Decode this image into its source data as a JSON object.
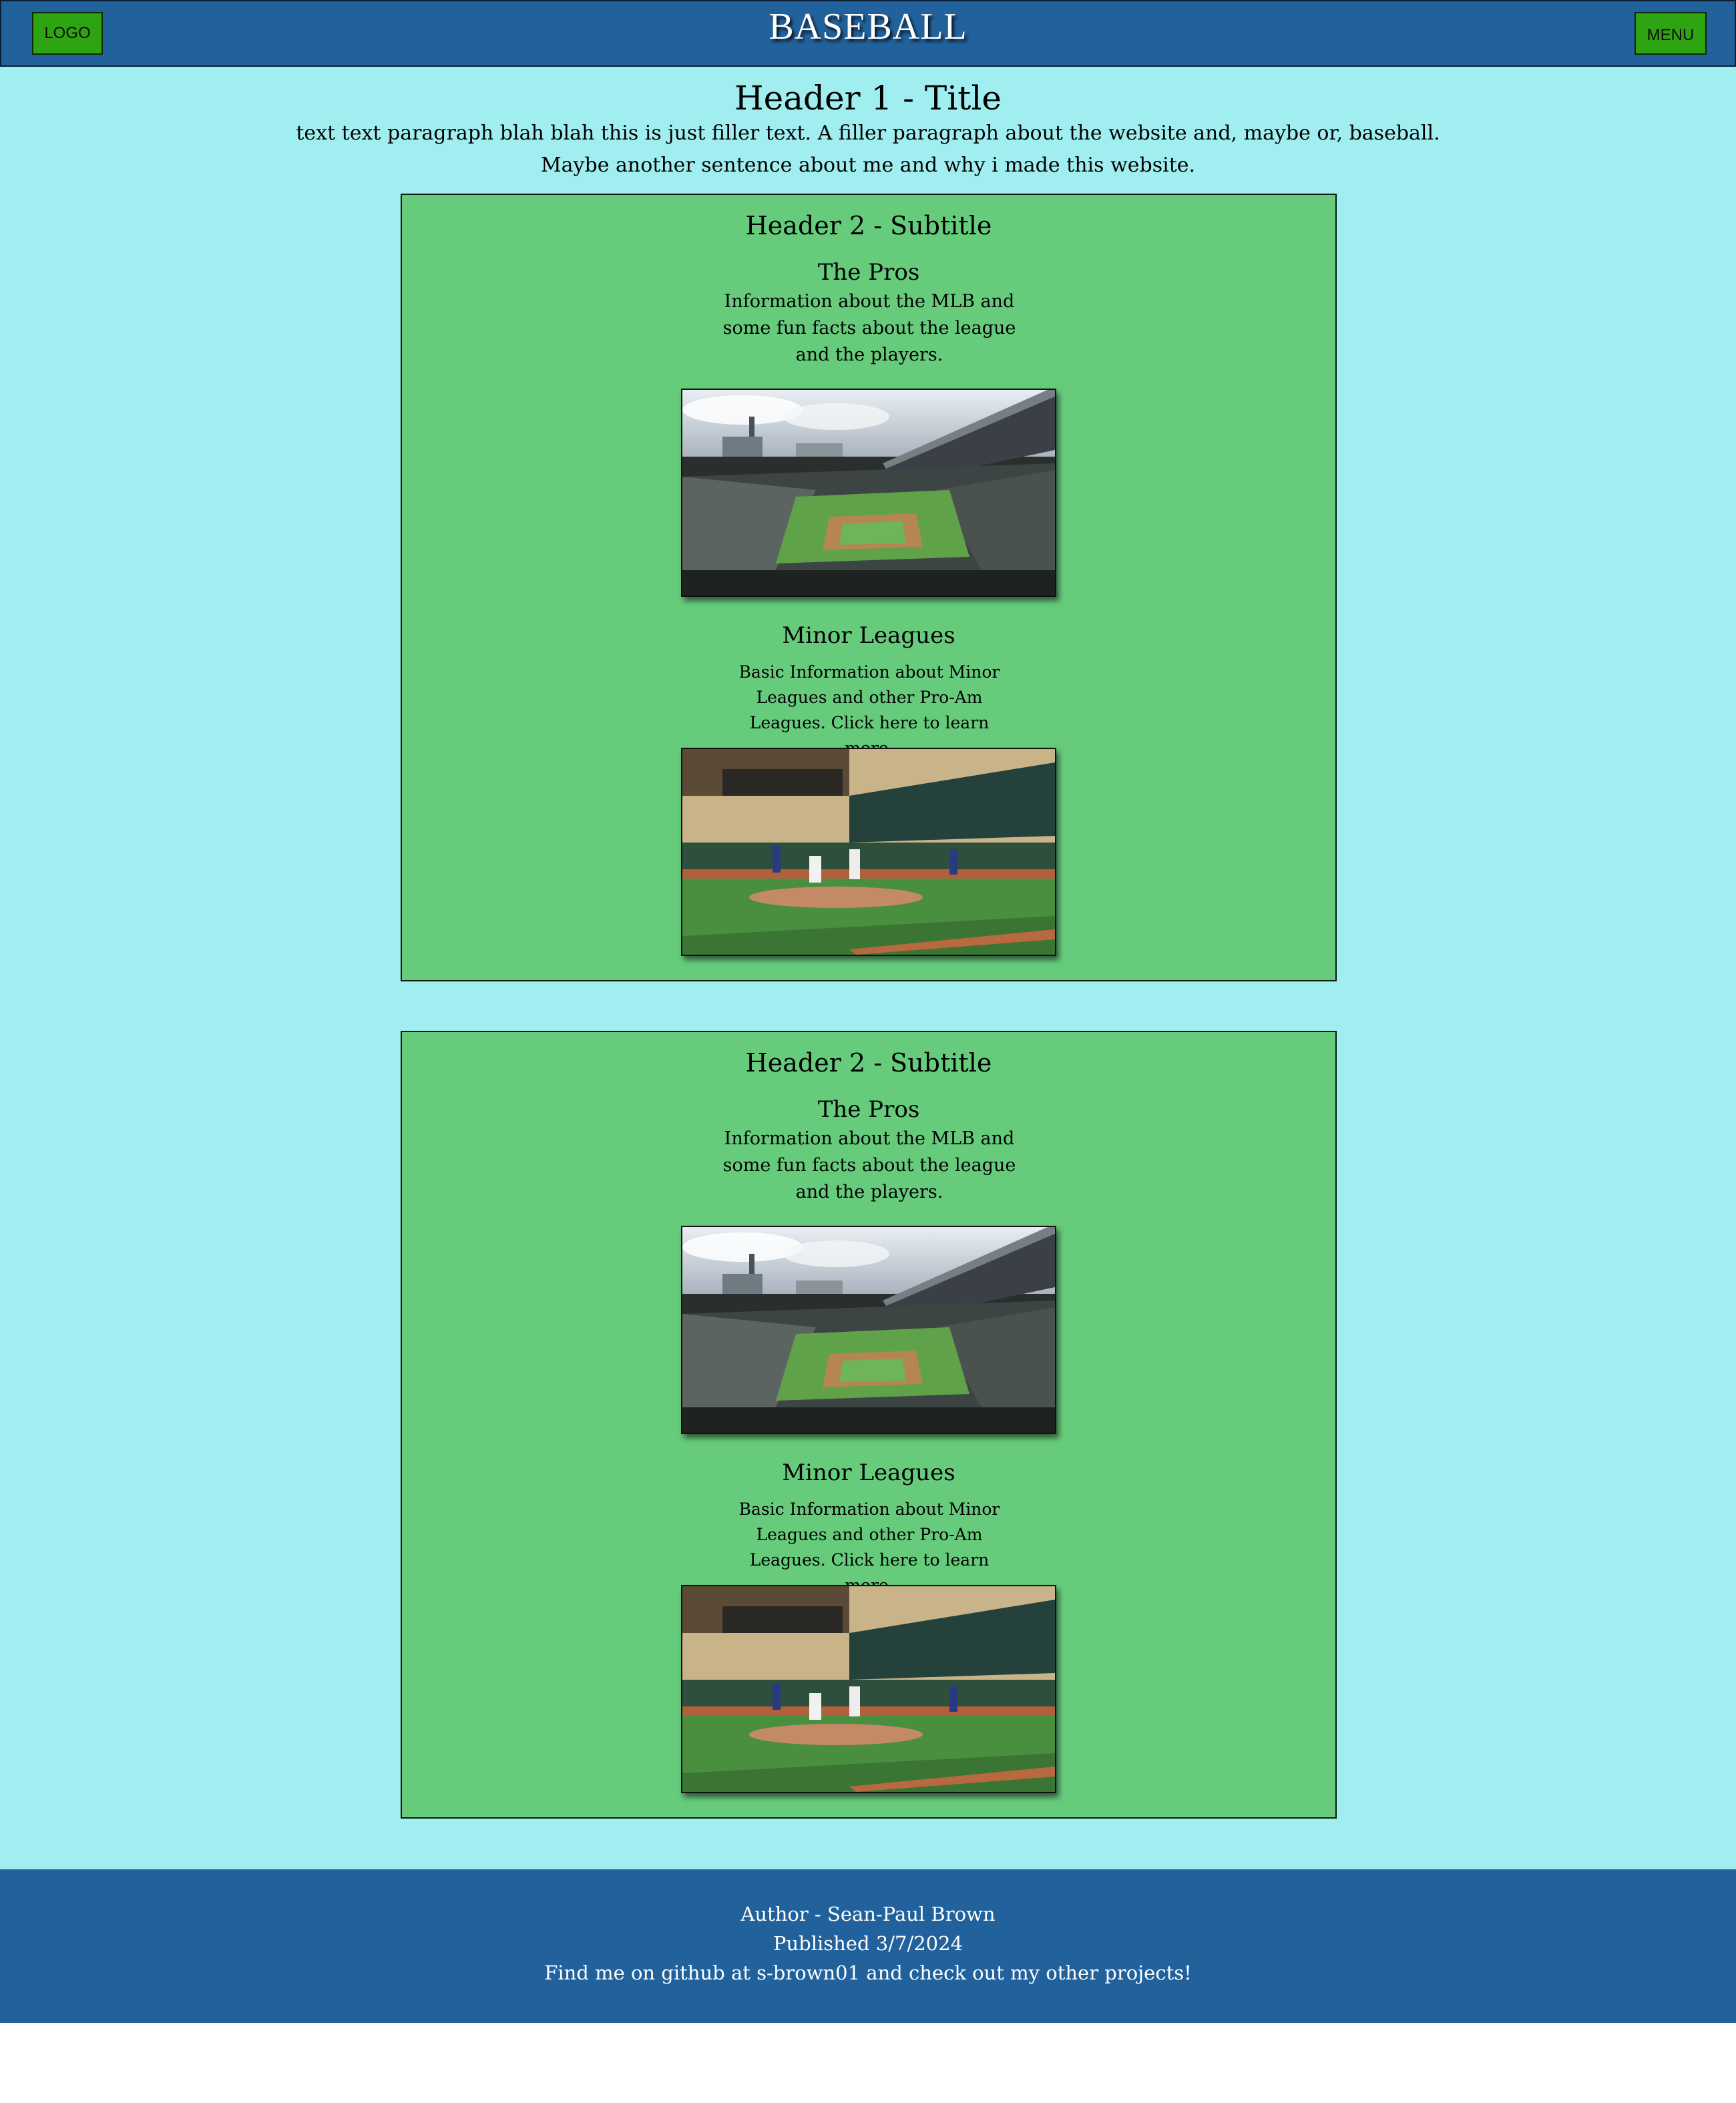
{
  "header": {
    "logo_label": "LOGO",
    "site_title": "BASEBALL",
    "menu_label": "MENU"
  },
  "intro": {
    "title": "Header 1 - Title",
    "paragraph": "text text paragraph blah blah this is just filler text. A filler paragraph about the website and, maybe or, baseball. Maybe another sentence about me and why i made this website."
  },
  "sections": [
    {
      "title": "Header 2 - Subtitle",
      "pros_title": "The Pros",
      "pros_text": "Information about the MLB and some fun facts about the league and the players.",
      "minor_title": "Minor Leagues",
      "minor_text": "Basic Information about Minor Leagues and other Pro-Am Leagues. Click here to learn more."
    },
    {
      "title": "Header 2 - Subtitle",
      "pros_title": "The Pros",
      "pros_text": "Information about the MLB and some fun facts about the league and the players.",
      "minor_title": "Minor Leagues",
      "minor_text": "Basic Information about Minor Leagues and other Pro-Am Leagues. Click here to learn more."
    }
  ],
  "footer": {
    "author": "Author - Sean-Paul Brown",
    "published": "Published 3/7/2024",
    "github": "Find me on github at s-brown01 and check out my other projects!"
  },
  "colors": {
    "header_bg": "#22629c",
    "page_bg": "#a0eef0",
    "section_bg": "#66cc7c",
    "button_bg": "#2fa412"
  }
}
